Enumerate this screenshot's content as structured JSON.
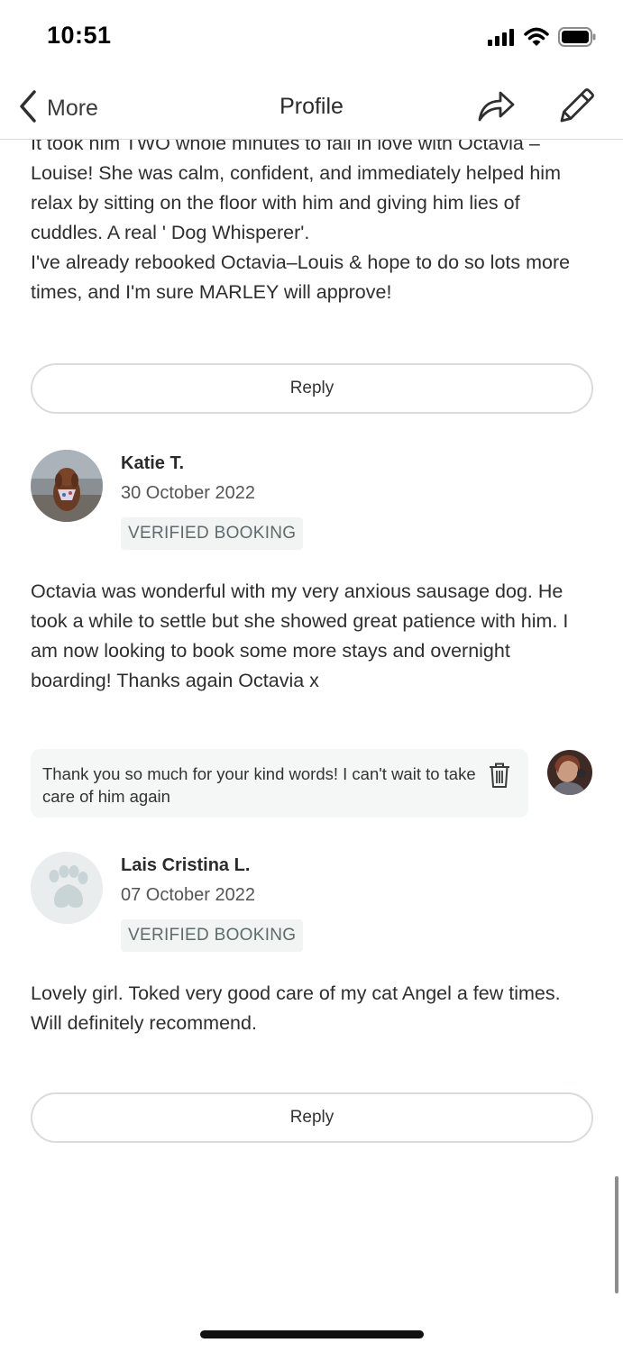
{
  "status_bar": {
    "time": "10:51",
    "icons": [
      "signal-icon",
      "wifi-icon",
      "battery-icon"
    ]
  },
  "nav": {
    "back_label": "More",
    "title": "Profile",
    "icons": [
      "chevron-left-icon",
      "share-icon",
      "pencil-icon"
    ]
  },
  "reviews": [
    {
      "text": "It took him TWO whole minutes to fall in love with Octavia –\nLouise! She was calm, confident,  and immediately helped him\nrelax by  sitting on the floor with him and giving him lies of\ncuddles. A real ' Dog Whisperer'.\nI've already rebooked Octavia–Louis & hope to do so  lots more\ntimes,  and I'm sure MARLEY will   approve!",
      "reply_label": "Reply"
    },
    {
      "name": "Katie T.",
      "date": "30 October 2022",
      "badge": "VERIFIED BOOKING",
      "avatar": "dog-photo",
      "text": "Octavia was wonderful with my very anxious sausage dog. He\ntook a while to settle but she showed great patience with him. I\nam now looking to book some more stays and overnight\nboarding! Thanks again Octavia x",
      "owner_reply": {
        "text": "Thank you so much for your kind words! I can't wait to take care of him again",
        "avatar": "owner-photo"
      }
    },
    {
      "name": "Lais Cristina L.",
      "date": "07 October 2022",
      "badge": "VERIFIED BOOKING",
      "avatar": "paw-placeholder",
      "text": "Lovely girl. Toked very good care of my cat Angel a few times.\nWill definitely recommend.",
      "reply_label": "Reply"
    }
  ],
  "colors": {
    "text": "#2e2e2e",
    "muted": "#5f6a6a",
    "border": "#d8dcdc",
    "badge_bg": "#f2f4f4",
    "reply_bg": "#f5f6f6"
  }
}
